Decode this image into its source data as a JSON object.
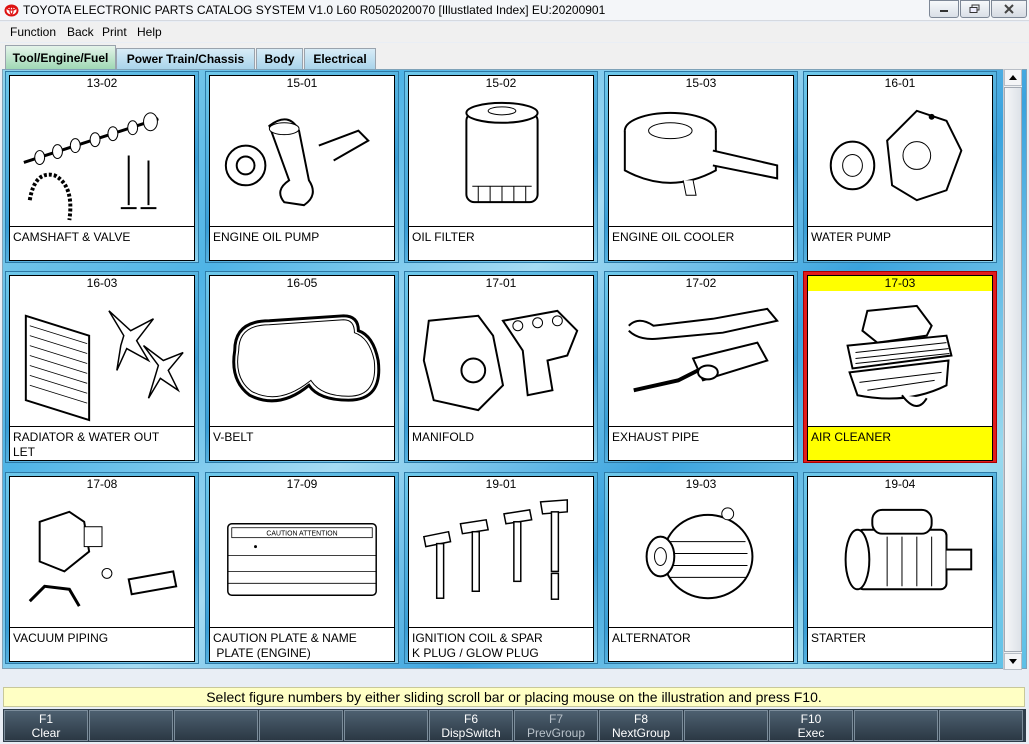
{
  "window": {
    "title": "TOYOTA ELECTRONIC PARTS CATALOG SYSTEM V1.0 L60 R0502020070 [Illustlated Index] EU:20200901"
  },
  "menu": [
    "Function",
    "Back",
    "Print",
    "Help"
  ],
  "tabs": [
    {
      "label": "Tool/Engine/Fuel",
      "active": true
    },
    {
      "label": "Power Train/Chassis",
      "active": false
    },
    {
      "label": "Body",
      "active": false
    },
    {
      "label": "Electrical",
      "active": false
    }
  ],
  "grid": [
    {
      "number": "13-02",
      "label": "CAMSHAFT & VALVE",
      "icon": "camshaft-valve-drawing"
    },
    {
      "number": "15-01",
      "label": "ENGINE OIL PUMP",
      "icon": "oil-pump-drawing"
    },
    {
      "number": "15-02",
      "label": "OIL FILTER",
      "icon": "oil-filter-drawing"
    },
    {
      "number": "15-03",
      "label": "ENGINE OIL COOLER",
      "icon": "oil-cooler-drawing"
    },
    {
      "number": "16-01",
      "label": "WATER PUMP",
      "icon": "water-pump-drawing"
    },
    {
      "number": "16-03",
      "label": "RADIATOR & WATER OUT\nLET",
      "icon": "radiator-drawing"
    },
    {
      "number": "16-05",
      "label": "V-BELT",
      "icon": "v-belt-drawing"
    },
    {
      "number": "17-01",
      "label": "MANIFOLD",
      "icon": "manifold-drawing"
    },
    {
      "number": "17-02",
      "label": "EXHAUST PIPE",
      "icon": "exhaust-pipe-drawing"
    },
    {
      "number": "17-03",
      "label": "AIR CLEANER",
      "icon": "air-cleaner-drawing",
      "selected": true
    },
    {
      "number": "17-08",
      "label": "VACUUM PIPING",
      "icon": "vacuum-piping-drawing"
    },
    {
      "number": "17-09",
      "label": "CAUTION PLATE & NAME\n PLATE (ENGINE)",
      "icon": "caution-plate-drawing",
      "plate_text": "CAUTION  ATTENTION"
    },
    {
      "number": "19-01",
      "label": "IGNITION COIL & SPAR\nK PLUG / GLOW PLUG",
      "icon": "ignition-coil-drawing"
    },
    {
      "number": "19-03",
      "label": "ALTERNATOR",
      "icon": "alternator-drawing"
    },
    {
      "number": "19-04",
      "label": "STARTER",
      "icon": "starter-drawing"
    }
  ],
  "status": "Select figure numbers by either sliding scroll bar or placing mouse on the illustration and press F10.",
  "fkeys": [
    {
      "key": "F1",
      "label": "Clear"
    },
    {
      "key": "",
      "label": ""
    },
    {
      "key": "",
      "label": ""
    },
    {
      "key": "",
      "label": ""
    },
    {
      "key": "",
      "label": ""
    },
    {
      "key": "F6",
      "label": "DispSwitch"
    },
    {
      "key": "F7",
      "label": "PrevGroup",
      "dim": true
    },
    {
      "key": "F8",
      "label": "NextGroup"
    },
    {
      "key": "",
      "label": ""
    },
    {
      "key": "F10",
      "label": "Exec"
    },
    {
      "key": "",
      "label": ""
    },
    {
      "key": "",
      "label": ""
    }
  ],
  "colors": {
    "selected_border": "#e21c1c",
    "selected_fill": "#ffff00",
    "status_bg": "#ffffc4",
    "fkey_bg": "#2e3d4a"
  }
}
